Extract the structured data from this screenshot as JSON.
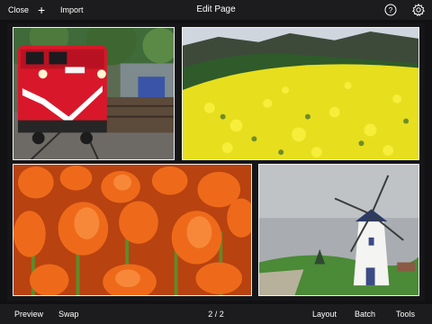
{
  "header": {
    "close_label": "Close",
    "add_icon": "plus-icon",
    "import_label": "Import",
    "title": "Edit Page",
    "help_icon": "question-icon",
    "settings_icon": "gear-icon"
  },
  "footer": {
    "preview_label": "Preview",
    "swap_label": "Swap",
    "page_indicator": "2 / 2",
    "layout_label": "Layout",
    "batch_label": "Batch",
    "tools_label": "Tools"
  },
  "photos": [
    {
      "name": "red-train"
    },
    {
      "name": "yellow-flower-field"
    },
    {
      "name": "orange-tulips"
    },
    {
      "name": "white-windmill"
    }
  ],
  "colors": {
    "bar_bg": "#1c1c1e",
    "canvas_bg": "#161618",
    "text": "#ffffff"
  }
}
